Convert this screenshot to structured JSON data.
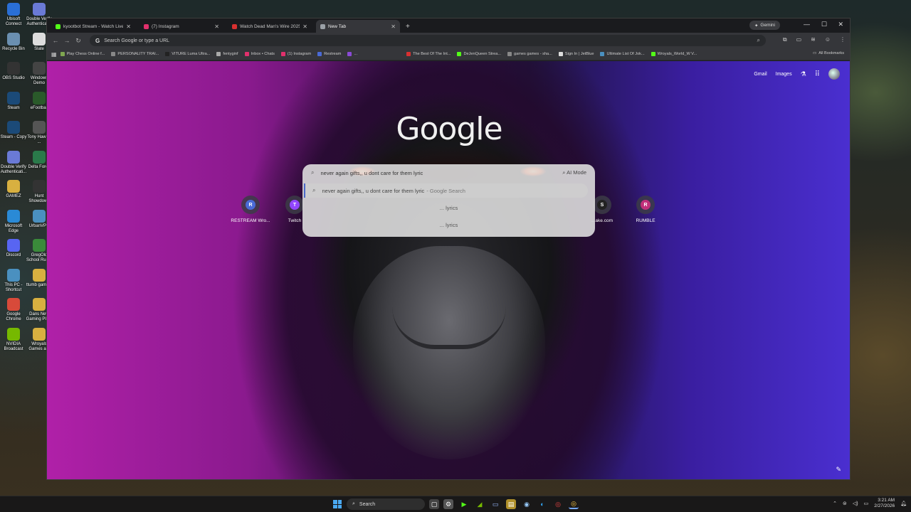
{
  "desktop": {
    "icons": [
      {
        "label": "Ubisoft Connect",
        "color": "#2a6fd6"
      },
      {
        "label": "Double Verify Authenticat...",
        "color": "#6a7ad6"
      },
      {
        "label": "Recycle Bin",
        "color": "#6a8fb0"
      },
      {
        "label": "Slate",
        "color": "#ddd"
      },
      {
        "label": "OBS Studio",
        "color": "#333"
      },
      {
        "label": "Windows Demo",
        "color": "#444"
      },
      {
        "label": "Steam",
        "color": "#1b4a78"
      },
      {
        "label": "eFootball",
        "color": "#2a5a2a"
      },
      {
        "label": "Steam - Copy",
        "color": "#1b4a78"
      },
      {
        "label": "Tony Hawk's ...",
        "color": "#555"
      },
      {
        "label": "Double Verify Authenticati...",
        "color": "#6a7ad6"
      },
      {
        "label": "Delta Force",
        "color": "#2a7a4a"
      },
      {
        "label": "GAMEZ",
        "color": "#d8b040"
      },
      {
        "label": "Hunt Showdown",
        "color": "#333"
      },
      {
        "label": "Microsoft Edge",
        "color": "#2a8ad6"
      },
      {
        "label": "UrbanVPN",
        "color": "#4a90c0"
      },
      {
        "label": "Discord",
        "color": "#5865f2"
      },
      {
        "label": "GregOld School Run...",
        "color": "#3a8a3a"
      },
      {
        "label": "This PC - Shortcut",
        "color": "#4a90c0"
      },
      {
        "label": "ttumb gaming",
        "color": "#d8b040"
      },
      {
        "label": "Google Chrome",
        "color": "#d84a3a"
      },
      {
        "label": "Dans New Gaming PICS",
        "color": "#d8b040"
      },
      {
        "label": "NVIDIA Broadcast",
        "color": "#76b900"
      },
      {
        "label": "Wroyals Games a...",
        "color": "#d8b040"
      }
    ]
  },
  "browser": {
    "tabs": [
      {
        "label": "kyootbot Stream - Watch Live o",
        "color": "#53fc18",
        "active": false
      },
      {
        "label": "(7) Instagram",
        "color": "#e1306c",
        "active": false
      },
      {
        "label": "Watch Dead Man's Wire 2025 -",
        "color": "#d83030",
        "active": false
      },
      {
        "label": "New Tab",
        "color": "#9aa0a6",
        "active": true
      }
    ],
    "new_tab": "+",
    "gemini": "Gemini",
    "omnibox_placeholder": "Search Google or type a URL",
    "bookmarks": [
      {
        "label": "Play Chess Online f...",
        "color": "#7fa650"
      },
      {
        "label": "PERSONALITY TRAI...",
        "color": "#888"
      },
      {
        "label": "VITURE Luma Ultra...",
        "color": "#222"
      },
      {
        "label": "fentyginf",
        "color": "#aaa"
      },
      {
        "label": "Inbox • Chats",
        "color": "#e1306c"
      },
      {
        "label": "(1) Instagram",
        "color": "#e1306c"
      },
      {
        "label": "Restream",
        "color": "#4a6ad6"
      },
      {
        "label": "...",
        "color": "#8a4ad6"
      },
      {
        "label": "The Best Of The Int...",
        "color": "#d83030"
      },
      {
        "label": "DeJenQueen Strea...",
        "color": "#53fc18"
      },
      {
        "label": "games games - sha...",
        "color": "#888"
      },
      {
        "label": "Sign In | JetBlue",
        "color": "#ddd"
      },
      {
        "label": "Ultimate List Of Jok...",
        "color": "#4a90c0"
      },
      {
        "label": "Wroyals_World_W V...",
        "color": "#53fc18"
      }
    ],
    "all_bookmarks": "All Bookmarks"
  },
  "ntp": {
    "gmail": "Gmail",
    "images": "Images",
    "logo": "Google",
    "search_value": "never again gifts,, u dont care for them lyric",
    "ai_mode": "AI Mode",
    "suggestions": [
      {
        "text": "never again gifts,, u dont care for them lyric",
        "suffix": "- Google Search"
      },
      {
        "text": "... lyrics",
        "suffix": ""
      },
      {
        "text": "... lyrics",
        "suffix": ""
      }
    ],
    "shortcuts": [
      {
        "label": "RESTREAM Wro...",
        "letter": "R",
        "color": "#4a6ad6"
      },
      {
        "label": "Twitch",
        "letter": "T",
        "color": "#9146ff"
      },
      {
        "label": "...ake.com",
        "letter": "S",
        "color": "#222"
      },
      {
        "label": "RUMBLE",
        "letter": "R",
        "color": "#c0307a"
      }
    ]
  },
  "taskbar": {
    "search": "Search",
    "time": "3:21 AM",
    "date": "2/27/2026"
  }
}
